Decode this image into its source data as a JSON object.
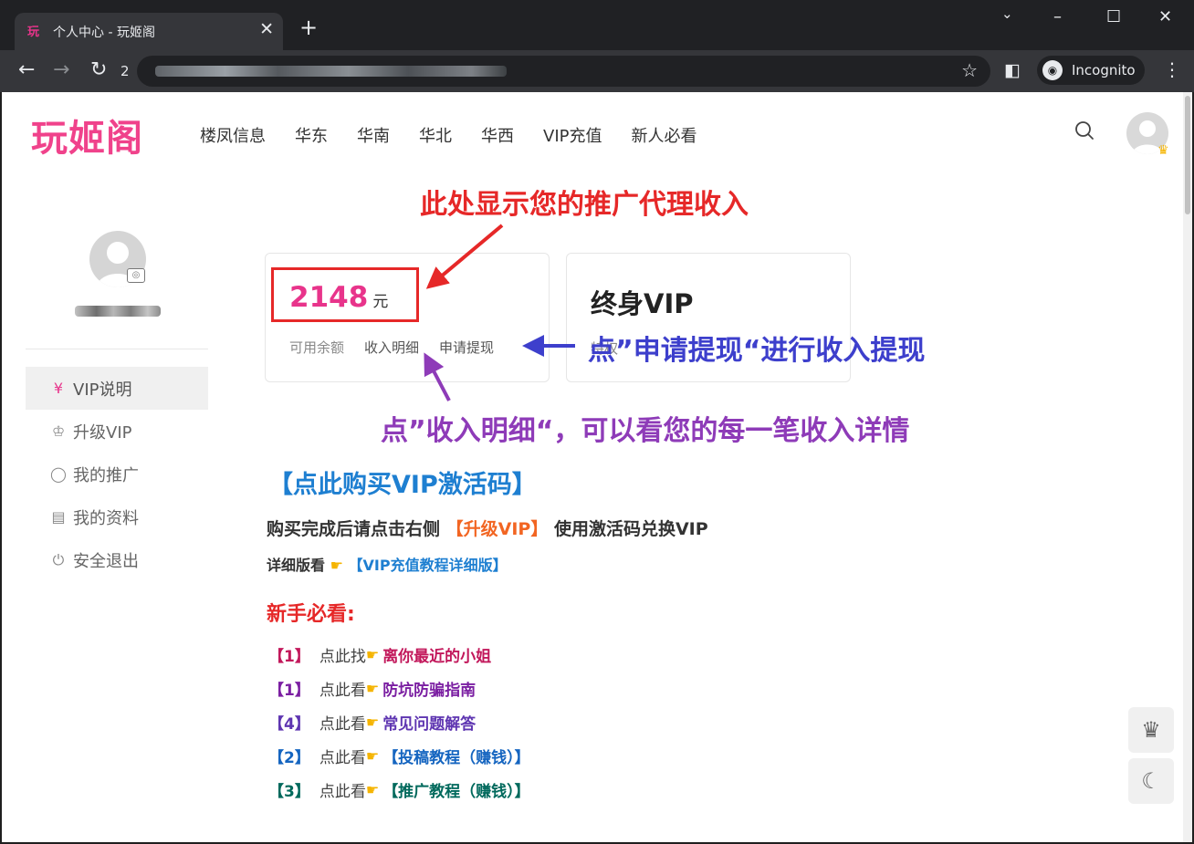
{
  "browser": {
    "tab_favicon": "玩",
    "tab_title": "个人中心 - 玩姬阁",
    "tab_close": "✕",
    "new_tab": "+",
    "url_fragment": "2",
    "incognito_label": "Incognito"
  },
  "site": {
    "logo": "玩姬阁",
    "nav": [
      "楼凤信息",
      "华东",
      "华南",
      "华北",
      "华西",
      "VIP充值",
      "新人必看"
    ]
  },
  "sidebar": {
    "menu": [
      {
        "label": "VIP说明",
        "icon": "yen-circle-icon",
        "glyph": "¥",
        "active": true
      },
      {
        "label": "升级VIP",
        "icon": "crown-icon",
        "glyph": "♔",
        "active": false
      },
      {
        "label": "我的推广",
        "icon": "circle-icon",
        "glyph": "◯",
        "active": false
      },
      {
        "label": "我的资料",
        "icon": "id-card-icon",
        "glyph": "▤",
        "active": false
      },
      {
        "label": "安全退出",
        "icon": "power-icon",
        "glyph": "⏻",
        "active": false
      }
    ]
  },
  "cards": {
    "balance_value": "2148",
    "balance_unit": "元",
    "balance_label": "可用余额",
    "income_detail": "收入明细",
    "withdraw": "申请提现",
    "vip_title": "终身VIP",
    "vip_sub": "特权"
  },
  "annotations": {
    "income_note": "此处显示您的推广代理收入",
    "withdraw_note": "点”申请提现“进行收入提现",
    "detail_note": "点”收入明细“，可以看您的每一笔收入详情"
  },
  "main": {
    "buy_link": "【点此购买VIP激活码】",
    "line1_pre": "购买完成后请点击右侧",
    "line1_hl": "【升级VIP】",
    "line1_post": "使用激活码兑换VIP",
    "line2_pre": "详细版看",
    "line2_link": "【VIP充值教程详细版】",
    "newbie_title": "新手必看:",
    "guides": [
      {
        "num": "【1】",
        "text": "点此找",
        "link": "离你最近的小姐",
        "color": "#c2185b"
      },
      {
        "num": "【1】",
        "text": "点此看",
        "link": "防坑防骗指南",
        "color": "#7b1fa2"
      },
      {
        "num": "【4】",
        "text": "点此看",
        "link": "常见问题解答",
        "color": "#5e35b1"
      },
      {
        "num": "【2】",
        "text": "点此看",
        "link": "【投稿教程（赚钱）】",
        "color": "#1565c0"
      },
      {
        "num": "【3】",
        "text": "点此看",
        "link": "【推广教程（赚钱）】",
        "color": "#00695c"
      }
    ]
  },
  "colors": {
    "brand": "#f0428b",
    "annotation_red": "#e62828",
    "annotation_blue": "#3d3fcc",
    "annotation_purple": "#8e3bb8",
    "link_blue": "#1e7fd1"
  }
}
